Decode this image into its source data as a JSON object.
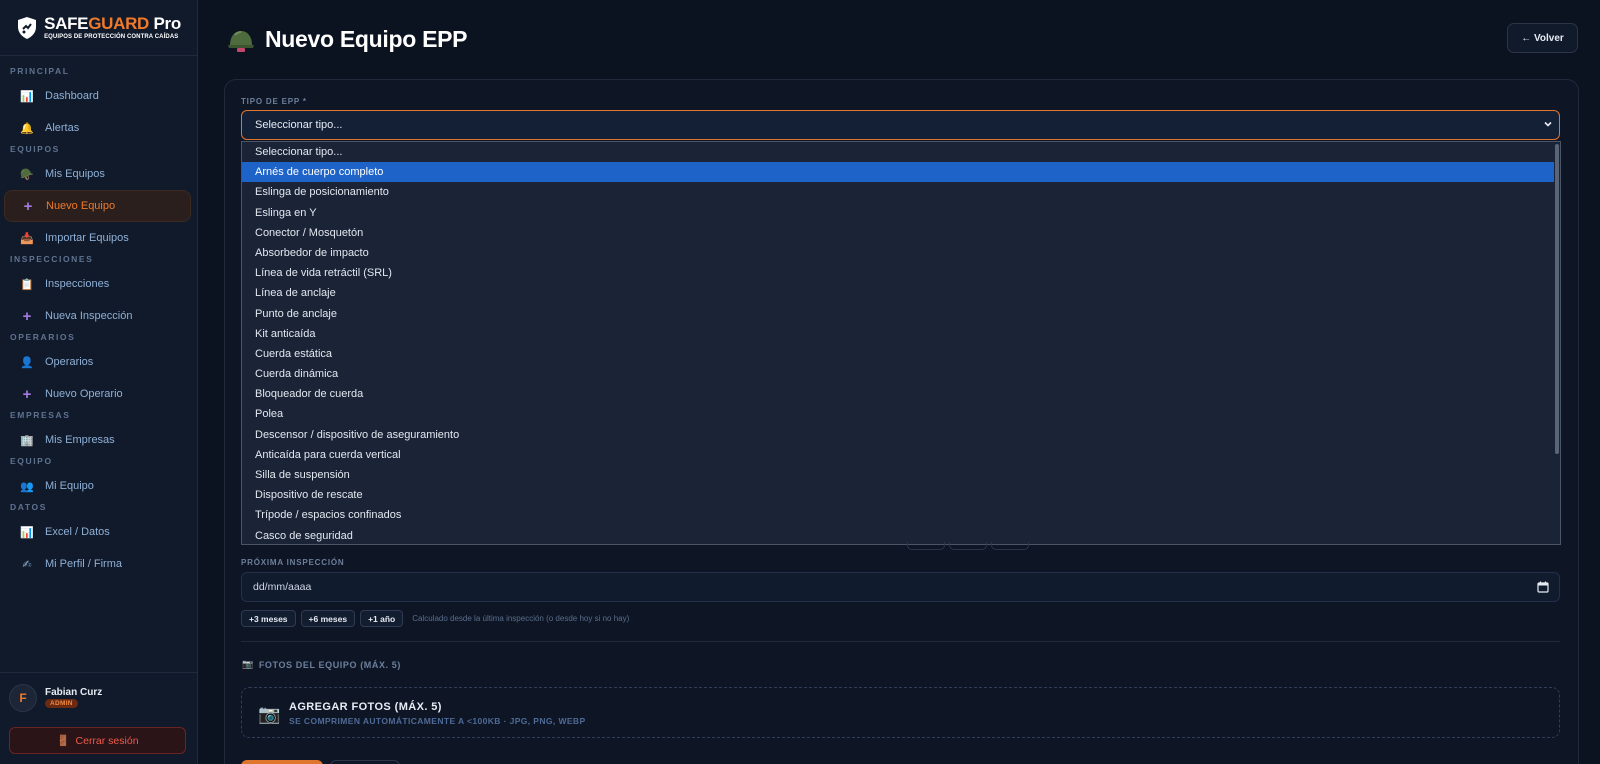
{
  "brand": {
    "name_part1": "SAFE",
    "name_part2": "GUARD",
    "name_part3": " Pro",
    "tagline": "EQUIPOS DE PROTECCIÓN CONTRA CAÍDAS",
    "accent_color": "#f07a2a"
  },
  "sidebar": {
    "sections": [
      {
        "label": "PRINCIPAL",
        "items": [
          {
            "icon": "📊",
            "label": "Dashboard",
            "active": false
          },
          {
            "icon": "🔔",
            "label": "Alertas",
            "active": false
          }
        ]
      },
      {
        "label": "EQUIPOS",
        "items": [
          {
            "icon": "🪖",
            "label": "Mis Equipos",
            "active": false
          },
          {
            "icon": "+",
            "label": "Nuevo Equipo",
            "active": true
          },
          {
            "icon": "📥",
            "label": "Importar Equipos",
            "active": false
          }
        ]
      },
      {
        "label": "INSPECCIONES",
        "items": [
          {
            "icon": "📋",
            "label": "Inspecciones",
            "active": false
          },
          {
            "icon": "+",
            "label": "Nueva Inspección",
            "active": false
          }
        ]
      },
      {
        "label": "OPERARIOS",
        "items": [
          {
            "icon": "👤",
            "label": "Operarios",
            "active": false
          },
          {
            "icon": "+",
            "label": "Nuevo Operario",
            "active": false
          }
        ]
      },
      {
        "label": "EMPRESAS",
        "items": [
          {
            "icon": "🏢",
            "label": "Mis Empresas",
            "active": false
          }
        ]
      },
      {
        "label": "EQUIPO",
        "items": [
          {
            "icon": "👥",
            "label": "Mi Equipo",
            "active": false
          }
        ]
      },
      {
        "label": "DATOS",
        "items": [
          {
            "icon": "📊",
            "label": "Excel / Datos",
            "active": false
          },
          {
            "icon": "✍",
            "label": "Mi Perfil / Firma",
            "active": false
          }
        ]
      }
    ],
    "user": {
      "initial": "F",
      "name": "Fabian Curz",
      "role": "ADMIN"
    },
    "logout_label": "Cerrar sesión"
  },
  "header": {
    "title": "Nuevo Equipo EPP",
    "back_label": "← Volver"
  },
  "form": {
    "type_label": "TIPO DE EPP *",
    "type_selected": "Seleccionar tipo...",
    "type_options": [
      "Seleccionar tipo...",
      "Arnés de cuerpo completo",
      "Eslinga de posicionamiento",
      "Eslinga en Y",
      "Conector / Mosquetón",
      "Absorbedor de impacto",
      "Línea de vida retráctil (SRL)",
      "Línea de anclaje",
      "Punto de anclaje",
      "Kit anticaída",
      "Cuerda estática",
      "Cuerda dinámica",
      "Bloqueador de cuerda",
      "Polea",
      "Descensor / dispositivo de aseguramiento",
      "Anticaída para cuerda vertical",
      "Silla de suspensión",
      "Dispositivo de rescate",
      "Trípode / espacios confinados",
      "Casco de seguridad"
    ],
    "highlighted_option_index": 1,
    "next_inspection_label": "PRÓXIMA INSPECCIÓN",
    "next_inspection_placeholder": "dd/mm/aaaa",
    "quick_buttons": [
      "+3 meses",
      "+6 meses",
      "+1 año"
    ],
    "quick_note": "Calculado desde la última inspección (o desde hoy si no hay)",
    "photos_label": "FOTOS DEL EQUIPO (MÁX. 5)",
    "dropzone_title": "AGREGAR FOTOS (MÁX. 5)",
    "dropzone_subtitle": "SE COMPRIMEN AUTOMÁTICAMENTE A <100KB · JPG, PNG, WEBP"
  }
}
